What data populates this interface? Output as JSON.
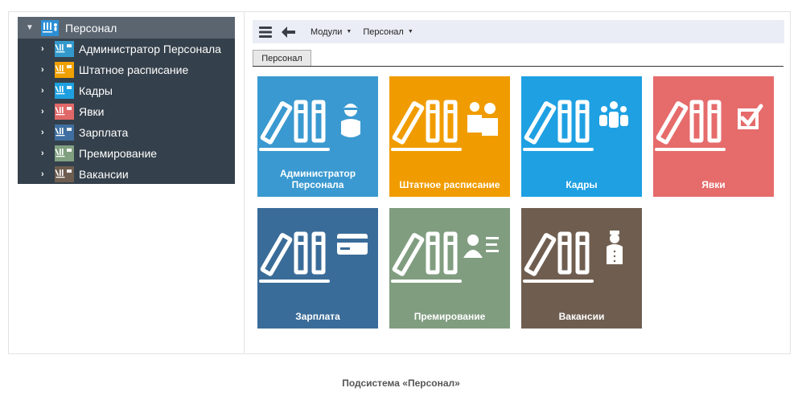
{
  "tree": {
    "root": {
      "label": "Персонал",
      "icon": "personnel-module-icon"
    },
    "items": [
      {
        "label": "Администратор Персонала",
        "color": "#3399cc",
        "icon": "admin-module-icon"
      },
      {
        "label": "Штатное расписание",
        "color": "#f0a000",
        "icon": "staffing-module-icon"
      },
      {
        "label": "Кадры",
        "color": "#1ea0e0",
        "icon": "hr-module-icon"
      },
      {
        "label": "Явки",
        "color": "#e06868",
        "icon": "attendance-module-icon"
      },
      {
        "label": "Зарплата",
        "color": "#3f6fa0",
        "icon": "salary-module-icon"
      },
      {
        "label": "Премирование",
        "color": "#80a080",
        "icon": "bonus-module-icon"
      },
      {
        "label": "Вакансии",
        "color": "#6e5e50",
        "icon": "vacancy-module-icon"
      }
    ]
  },
  "toolbar": {
    "menu_icon": "hamburger-icon",
    "back_icon": "arrow-left-icon",
    "modules_label": "Модули",
    "personnel_label": "Персонал"
  },
  "tab": {
    "label": "Персонал"
  },
  "tiles": [
    {
      "label": "Администратор Персонала",
      "color": "#3a99d0",
      "icon": "spy-person-icon"
    },
    {
      "label": "Штатное расписание",
      "color": "#f09c00",
      "icon": "two-persons-icon"
    },
    {
      "label": "Кадры",
      "color": "#1ea0e2",
      "icon": "group-icon"
    },
    {
      "label": "Явки",
      "color": "#e66b6b",
      "icon": "checkbox-icon"
    },
    {
      "label": "Зарплата",
      "color": "#3a6c99",
      "icon": "credit-card-icon"
    },
    {
      "label": "Премирование",
      "color": "#809d80",
      "icon": "person-card-icon"
    },
    {
      "label": "Вакансии",
      "color": "#6f5e50",
      "icon": "doorman-icon"
    }
  ],
  "caption": "Подсистема «Персонал»"
}
